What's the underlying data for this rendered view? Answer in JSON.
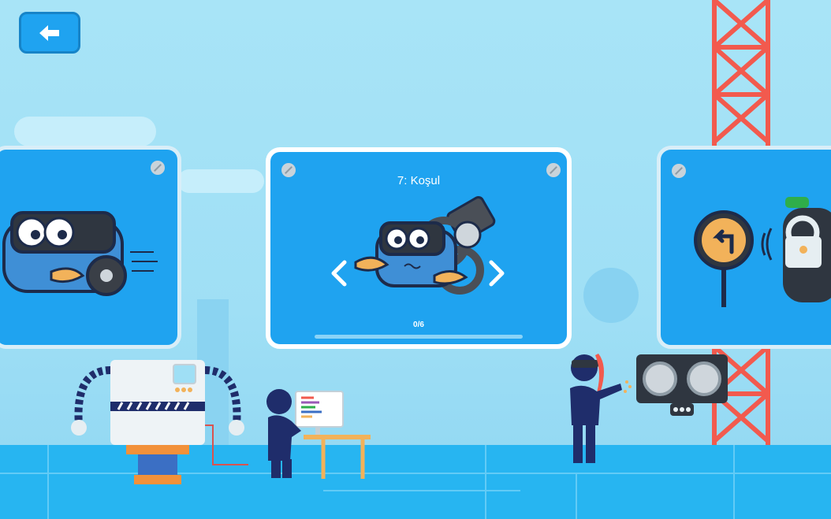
{
  "header": {
    "back_icon": "arrow-left-icon"
  },
  "carousel": {
    "current_level": {
      "title": "7: Koşul",
      "progress_text": "0/6",
      "progress_value": 0,
      "prev_icon": "chevron-left-icon",
      "next_icon": "chevron-right-icon"
    },
    "prev_level_icon": "robot-car-icon",
    "next_level_icon": "traffic-sign-lock-icon"
  },
  "colors": {
    "sky": "#a8e4f7",
    "card": "#1fa3f0",
    "ground": "#27b5f1",
    "crane": "#f25a4e",
    "navy": "#1f2d6b"
  }
}
